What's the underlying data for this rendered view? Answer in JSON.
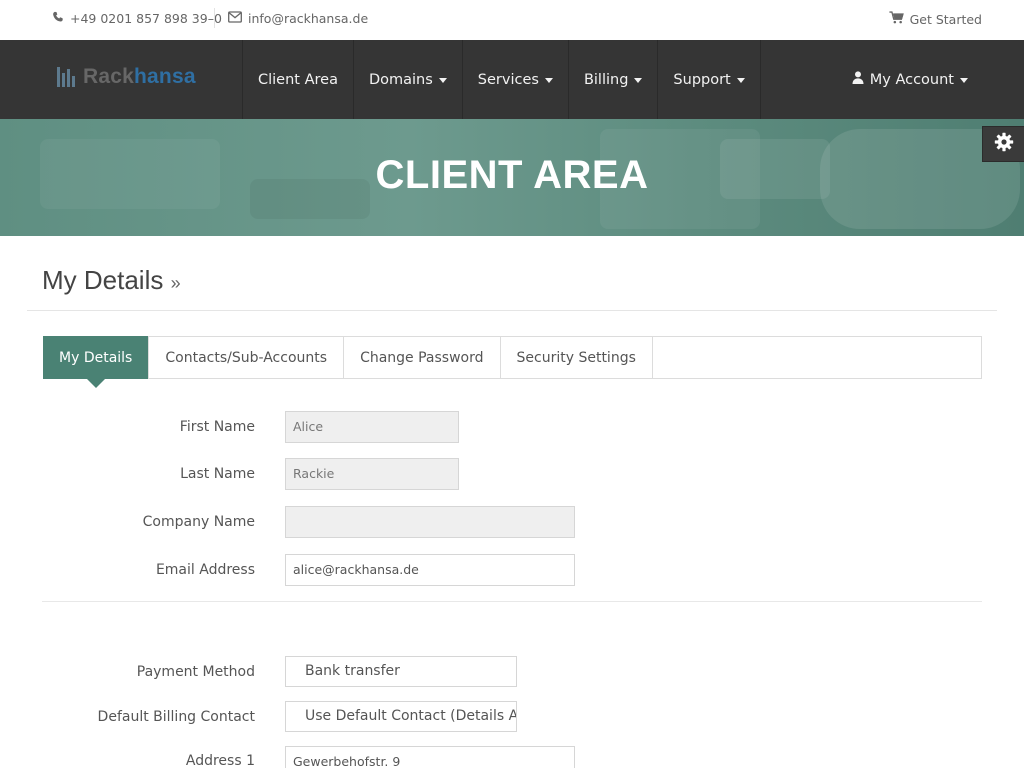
{
  "topbar": {
    "phone": "+49 0201 857 898 39–0",
    "email": "info@rackhansa.de",
    "get_started": "Get Started"
  },
  "brand": {
    "part1": "Rack",
    "part2": "hansa",
    "colors": {
      "rack": "#676767",
      "hansa": "#2f6fa3"
    }
  },
  "nav": {
    "items": [
      {
        "label": "Client Area",
        "dropdown": false
      },
      {
        "label": "Domains",
        "dropdown": true
      },
      {
        "label": "Services",
        "dropdown": true
      },
      {
        "label": "Billing",
        "dropdown": true
      },
      {
        "label": "Support",
        "dropdown": true
      }
    ],
    "account": "My Account"
  },
  "banner": {
    "title": "CLIENT AREA"
  },
  "page": {
    "title": "My Details",
    "title_suffix": "»"
  },
  "tabs": [
    {
      "label": "My Details",
      "active": true
    },
    {
      "label": "Contacts/Sub-Accounts",
      "active": false
    },
    {
      "label": "Change Password",
      "active": false
    },
    {
      "label": "Security Settings",
      "active": false
    }
  ],
  "form": {
    "first_name": {
      "label": "First Name",
      "value": "Alice"
    },
    "last_name": {
      "label": "Last Name",
      "value": "Rackie"
    },
    "company": {
      "label": "Company Name",
      "value": ""
    },
    "email": {
      "label": "Email Address",
      "value": "alice@rackhansa.de"
    },
    "payment_method": {
      "label": "Payment Method",
      "value": "Bank transfer"
    },
    "billing_contact": {
      "label": "Default Billing Contact",
      "value": "Use Default Contact (Details Above)"
    },
    "address1": {
      "label": "Address 1",
      "value": "Gewerbehofstr. 9"
    }
  },
  "colors": {
    "accent": "#4a8274",
    "nav_bg": "#353535",
    "banner": "#5f8f82"
  },
  "icons": [
    "phone-icon",
    "envelope-icon",
    "cart-icon",
    "user-icon",
    "gear-icon",
    "chevron-down-icon"
  ]
}
